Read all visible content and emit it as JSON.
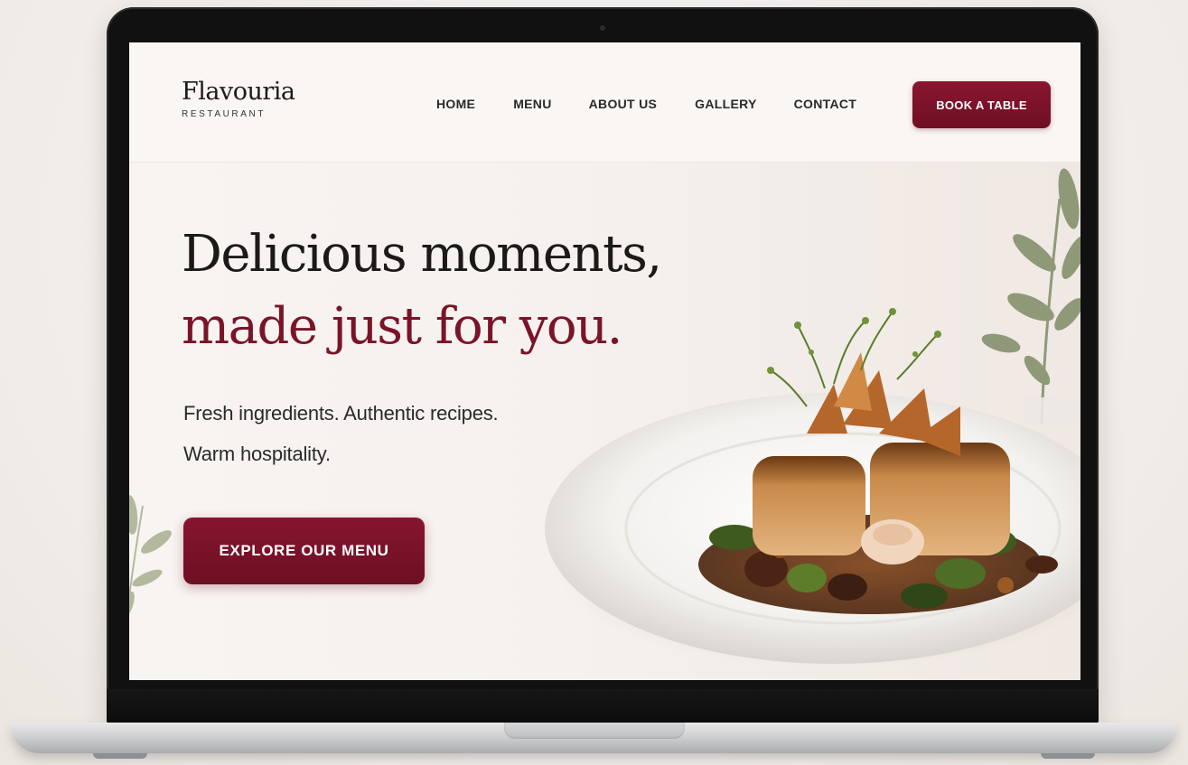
{
  "brand": {
    "name": "Flavouria",
    "subtitle": "RESTAURANT"
  },
  "nav": {
    "items": [
      "HOME",
      "MENU",
      "ABOUT US",
      "GALLERY",
      "CONTACT"
    ],
    "cta_label": "BOOK A TABLE"
  },
  "hero": {
    "headline_line1": "Delicious moments,",
    "headline_line2": "made just for you.",
    "tagline_line1": "Fresh ingredients. Authentic recipes.",
    "tagline_line2": "Warm hospitality.",
    "cta_label": "EXPLORE OUR MENU",
    "image_subject": "plated-dish"
  },
  "colors": {
    "brand_primary": "#7a1428",
    "background": "#f8f4f1",
    "text_dark": "#1c1a19",
    "laptop_bezel": "#111111",
    "laptop_base": "#cfd0d2"
  },
  "icons": {
    "decor_right": "plant-sprig-icon",
    "decor_left": "plant-sprig-icon"
  }
}
